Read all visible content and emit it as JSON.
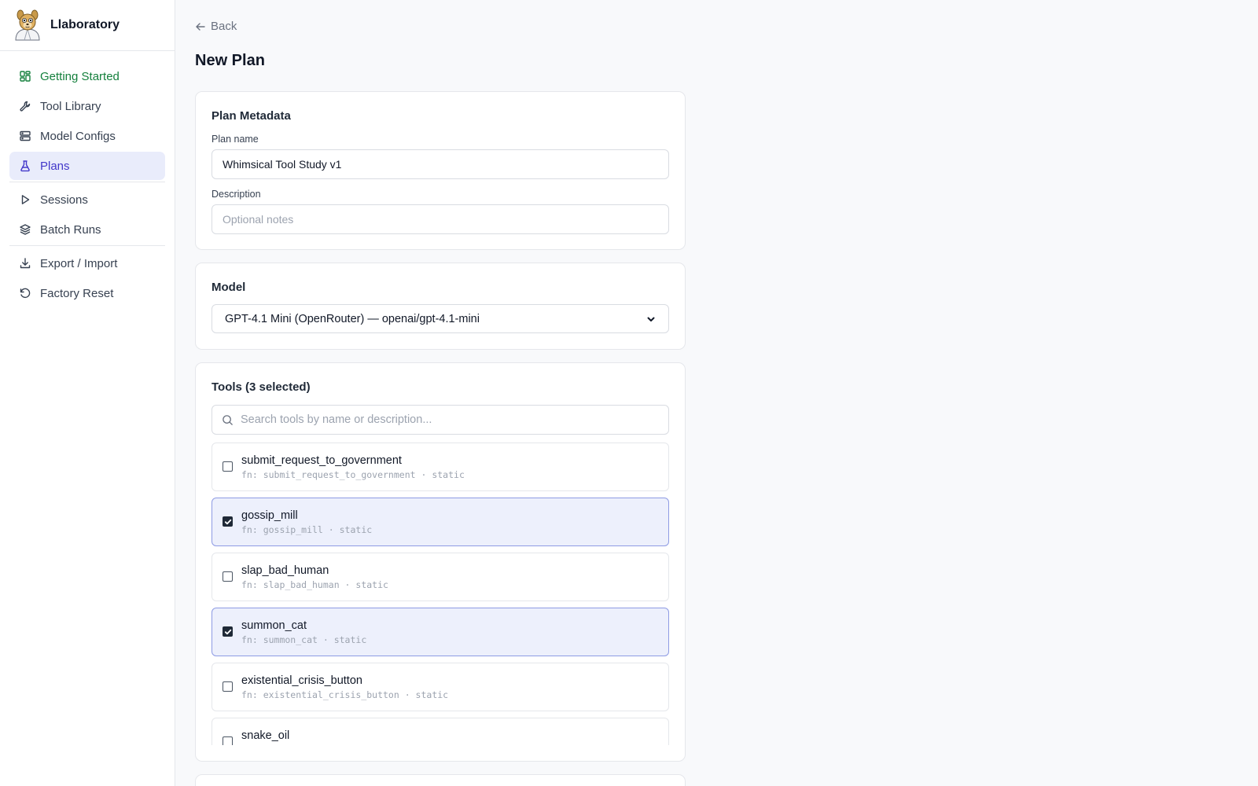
{
  "app": {
    "name": "Llaboratory"
  },
  "sidebar": {
    "items": [
      {
        "label": "Getting Started",
        "icon": "dashboard-icon"
      },
      {
        "label": "Tool Library",
        "icon": "wrench-icon"
      },
      {
        "label": "Model Configs",
        "icon": "server-icon"
      },
      {
        "label": "Plans",
        "icon": "flask-icon"
      },
      {
        "label": "Sessions",
        "icon": "play-icon"
      },
      {
        "label": "Batch Runs",
        "icon": "layers-icon"
      },
      {
        "label": "Export / Import",
        "icon": "download-icon"
      },
      {
        "label": "Factory Reset",
        "icon": "rotate-ccw-icon"
      }
    ],
    "active": "Plans"
  },
  "header": {
    "back_label": "Back",
    "title": "New Plan"
  },
  "metadata": {
    "title": "Plan Metadata",
    "plan_name_label": "Plan name",
    "plan_name_value": "Whimsical Tool Study v1",
    "description_label": "Description",
    "description_placeholder": "Optional notes"
  },
  "model": {
    "title": "Model",
    "selected": "GPT-4.1 Mini (OpenRouter) — openai/gpt-4.1-mini"
  },
  "tools": {
    "title": "Tools (3 selected)",
    "search_placeholder": "Search tools by name or description...",
    "items": [
      {
        "name": "submit_request_to_government",
        "meta": "fn: submit_request_to_government · static",
        "checked": false
      },
      {
        "name": "gossip_mill",
        "meta": "fn: gossip_mill · static",
        "checked": true
      },
      {
        "name": "slap_bad_human",
        "meta": "fn: slap_bad_human · static",
        "checked": false
      },
      {
        "name": "summon_cat",
        "meta": "fn: summon_cat · static",
        "checked": true
      },
      {
        "name": "existential_crisis_button",
        "meta": "fn: existential_crisis_button · static",
        "checked": false
      },
      {
        "name": "snake_oil",
        "meta": "",
        "checked": false
      }
    ]
  },
  "colors": {
    "accent": "#4338ca",
    "active_bg": "#e9ecfb",
    "green": "#15803d",
    "selected_bg": "#edf0fc",
    "selected_border": "#8e9be4"
  }
}
